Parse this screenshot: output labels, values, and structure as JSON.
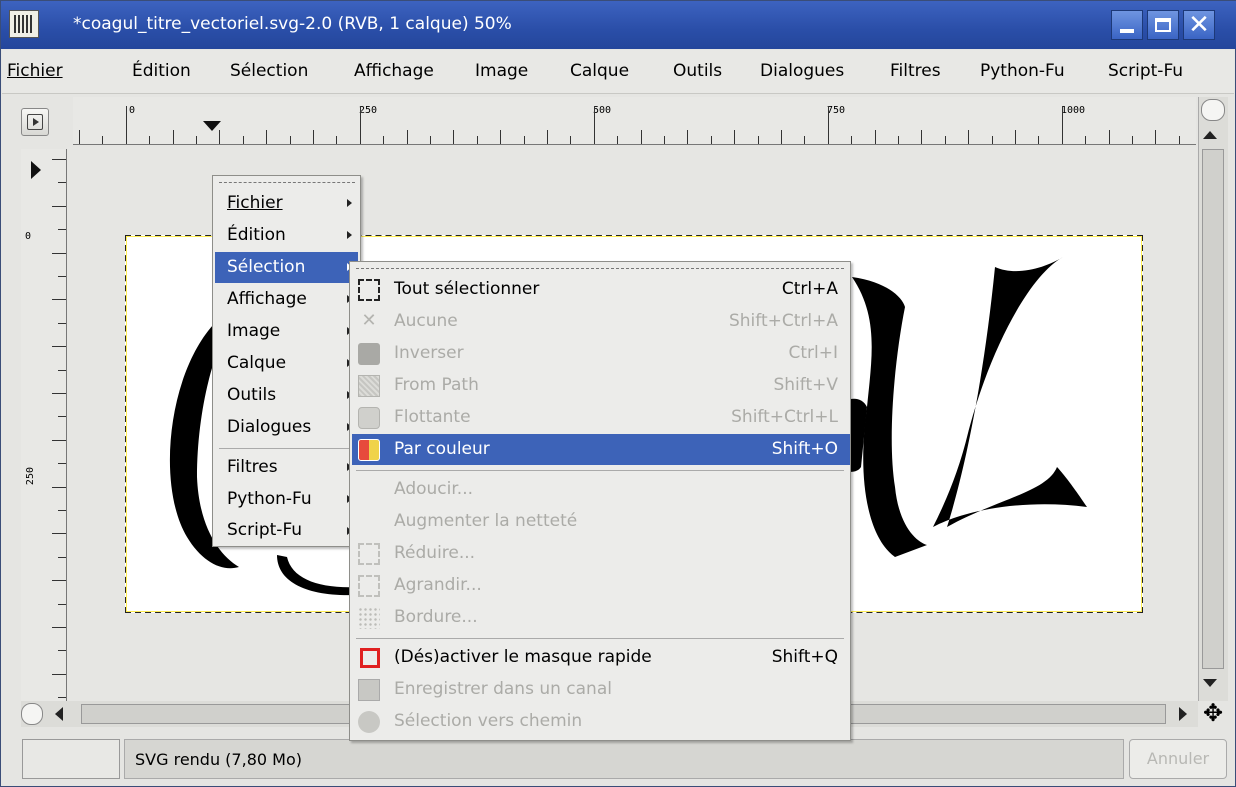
{
  "window": {
    "title": "*coagul_titre_vectoriel.svg-2.0 (RVB, 1 calque) 50%",
    "accent_color": "#3d63b8"
  },
  "menubar": {
    "items": [
      "Fichier",
      "Édition",
      "Sélection",
      "Affichage",
      "Image",
      "Calque",
      "Outils",
      "Dialogues",
      "Filtres",
      "Python-Fu",
      "Script-Fu"
    ]
  },
  "ruler": {
    "horizontal_labels": [
      "0",
      "250",
      "500",
      "750",
      "1000"
    ],
    "vertical_labels": [
      "0",
      "250"
    ]
  },
  "image_menu": {
    "items": [
      {
        "label": "Fichier"
      },
      {
        "label": "Édition"
      },
      {
        "label": "Sélection"
      },
      {
        "label": "Affichage"
      },
      {
        "label": "Image"
      },
      {
        "label": "Calque"
      },
      {
        "label": "Outils"
      },
      {
        "label": "Dialogues"
      },
      {
        "label": "Filtres"
      },
      {
        "label": "Python-Fu"
      },
      {
        "label": "Script-Fu"
      }
    ],
    "selected": "Sélection"
  },
  "selection_menu": {
    "items": [
      {
        "label": "Tout sélectionner",
        "shortcut": "Ctrl+A",
        "icon": "select-all-icon",
        "enabled": true
      },
      {
        "label": "Aucune",
        "shortcut": "Shift+Ctrl+A",
        "icon": "select-none-icon",
        "enabled": false
      },
      {
        "label": "Inverser",
        "shortcut": "Ctrl+I",
        "icon": "invert-selection-icon",
        "enabled": false
      },
      {
        "label": "From Path",
        "shortcut": "Shift+V",
        "icon": "path-to-selection-icon",
        "enabled": false
      },
      {
        "label": "Flottante",
        "shortcut": "Shift+Ctrl+L",
        "icon": "floating-selection-icon",
        "enabled": false
      },
      {
        "label": "Par couleur",
        "shortcut": "Shift+O",
        "icon": "select-by-color-icon",
        "enabled": true,
        "highlighted": true
      },
      {
        "label": "Adoucir...",
        "shortcut": "",
        "enabled": false
      },
      {
        "label": "Augmenter la netteté",
        "shortcut": "",
        "enabled": false
      },
      {
        "label": "Réduire...",
        "shortcut": "",
        "icon": "shrink-selection-icon",
        "enabled": false
      },
      {
        "label": "Agrandir...",
        "shortcut": "",
        "icon": "grow-selection-icon",
        "enabled": false
      },
      {
        "label": "Bordure...",
        "shortcut": "",
        "icon": "border-selection-icon",
        "enabled": false
      },
      {
        "label": "(Dés)activer le masque rapide",
        "shortcut": "Shift+Q",
        "icon": "quick-mask-icon",
        "enabled": true
      },
      {
        "label": "Enregistrer dans un canal",
        "shortcut": "",
        "icon": "save-to-channel-icon",
        "enabled": false
      },
      {
        "label": "Sélection vers chemin",
        "shortcut": "",
        "icon": "selection-to-path-icon",
        "enabled": false
      }
    ]
  },
  "statusbar": {
    "message": "SVG rendu (7,80 Mo)",
    "cancel_label": "Annuler"
  }
}
